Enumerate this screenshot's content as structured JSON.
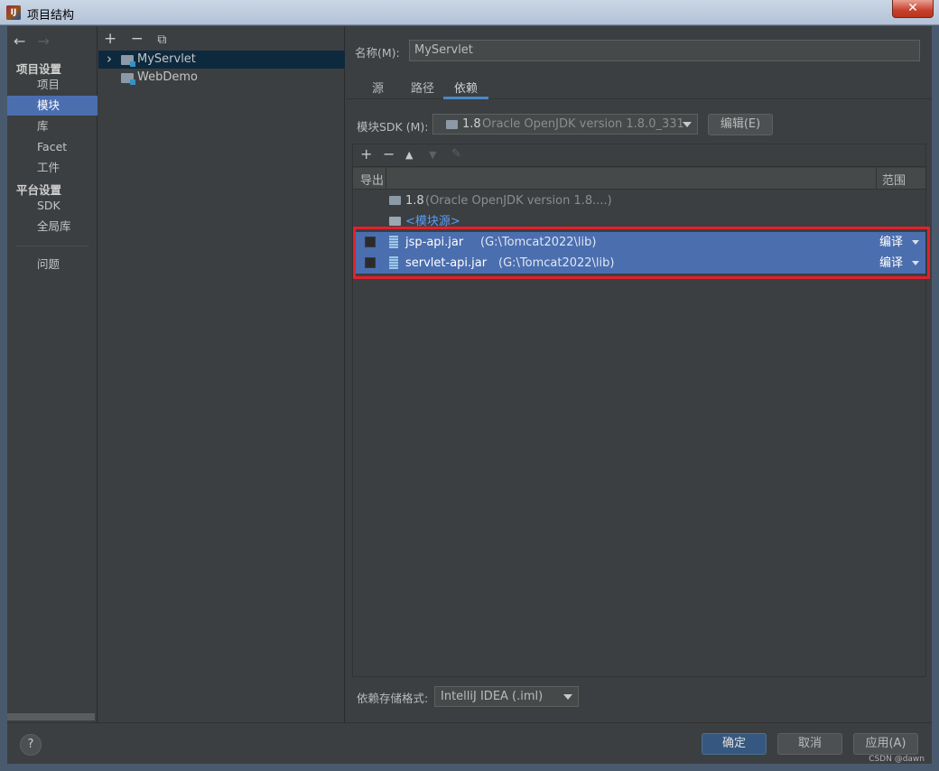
{
  "window": {
    "title": "项目结构",
    "app_icon_text": "IJ"
  },
  "nav": {
    "back_icon": "←",
    "forward_icon": "→",
    "group_project": "项目设置",
    "items_project": [
      "项目",
      "模块",
      "库",
      "Facet",
      "工件"
    ],
    "group_platform": "平台设置",
    "items_platform": [
      "SDK",
      "全局库"
    ],
    "problems": "问题",
    "selected": "模块"
  },
  "tree": {
    "toolbar": [
      "+",
      "−",
      "⧉"
    ],
    "modules": [
      "MyServlet",
      "WebDemo"
    ],
    "expand_icon": "›"
  },
  "module": {
    "name_label": "名称(M):",
    "name_value": "MyServlet",
    "tabs": [
      "源",
      "路径",
      "依赖"
    ],
    "active_tab": "依赖",
    "sdk_label": "模块SDK (M):",
    "sdk_version": "1.8",
    "sdk_detail": "Oracle OpenJDK version 1.8.0_331",
    "edit_button": "编辑(E)"
  },
  "deps": {
    "toolbar": [
      "+",
      "−",
      "▲",
      "▼",
      "✎"
    ],
    "col_export": "导出",
    "col_scope": "范围",
    "rows": [
      {
        "name": "1.8",
        "detail": "(Oracle OpenJDK version 1.8....)"
      },
      {
        "name": "<模块源>"
      }
    ],
    "jars": [
      {
        "name": "jsp-api.jar",
        "path": "(G:\\Tomcat2022\\lib)",
        "scope": "编译"
      },
      {
        "name": "servlet-api.jar",
        "path": "(G:\\Tomcat2022\\lib)",
        "scope": "编译"
      }
    ],
    "format_label": "依赖存储格式:",
    "format_value": "IntelliJ IDEA (.iml)"
  },
  "footer": {
    "help": "?",
    "ok": "确定",
    "cancel": "取消",
    "apply": "应用(A)",
    "watermark": "CSDN @dawn"
  },
  "colors": {
    "selection": "#4b6eaf",
    "highlight_box": "#e3202c",
    "background": "#3c3f41"
  }
}
